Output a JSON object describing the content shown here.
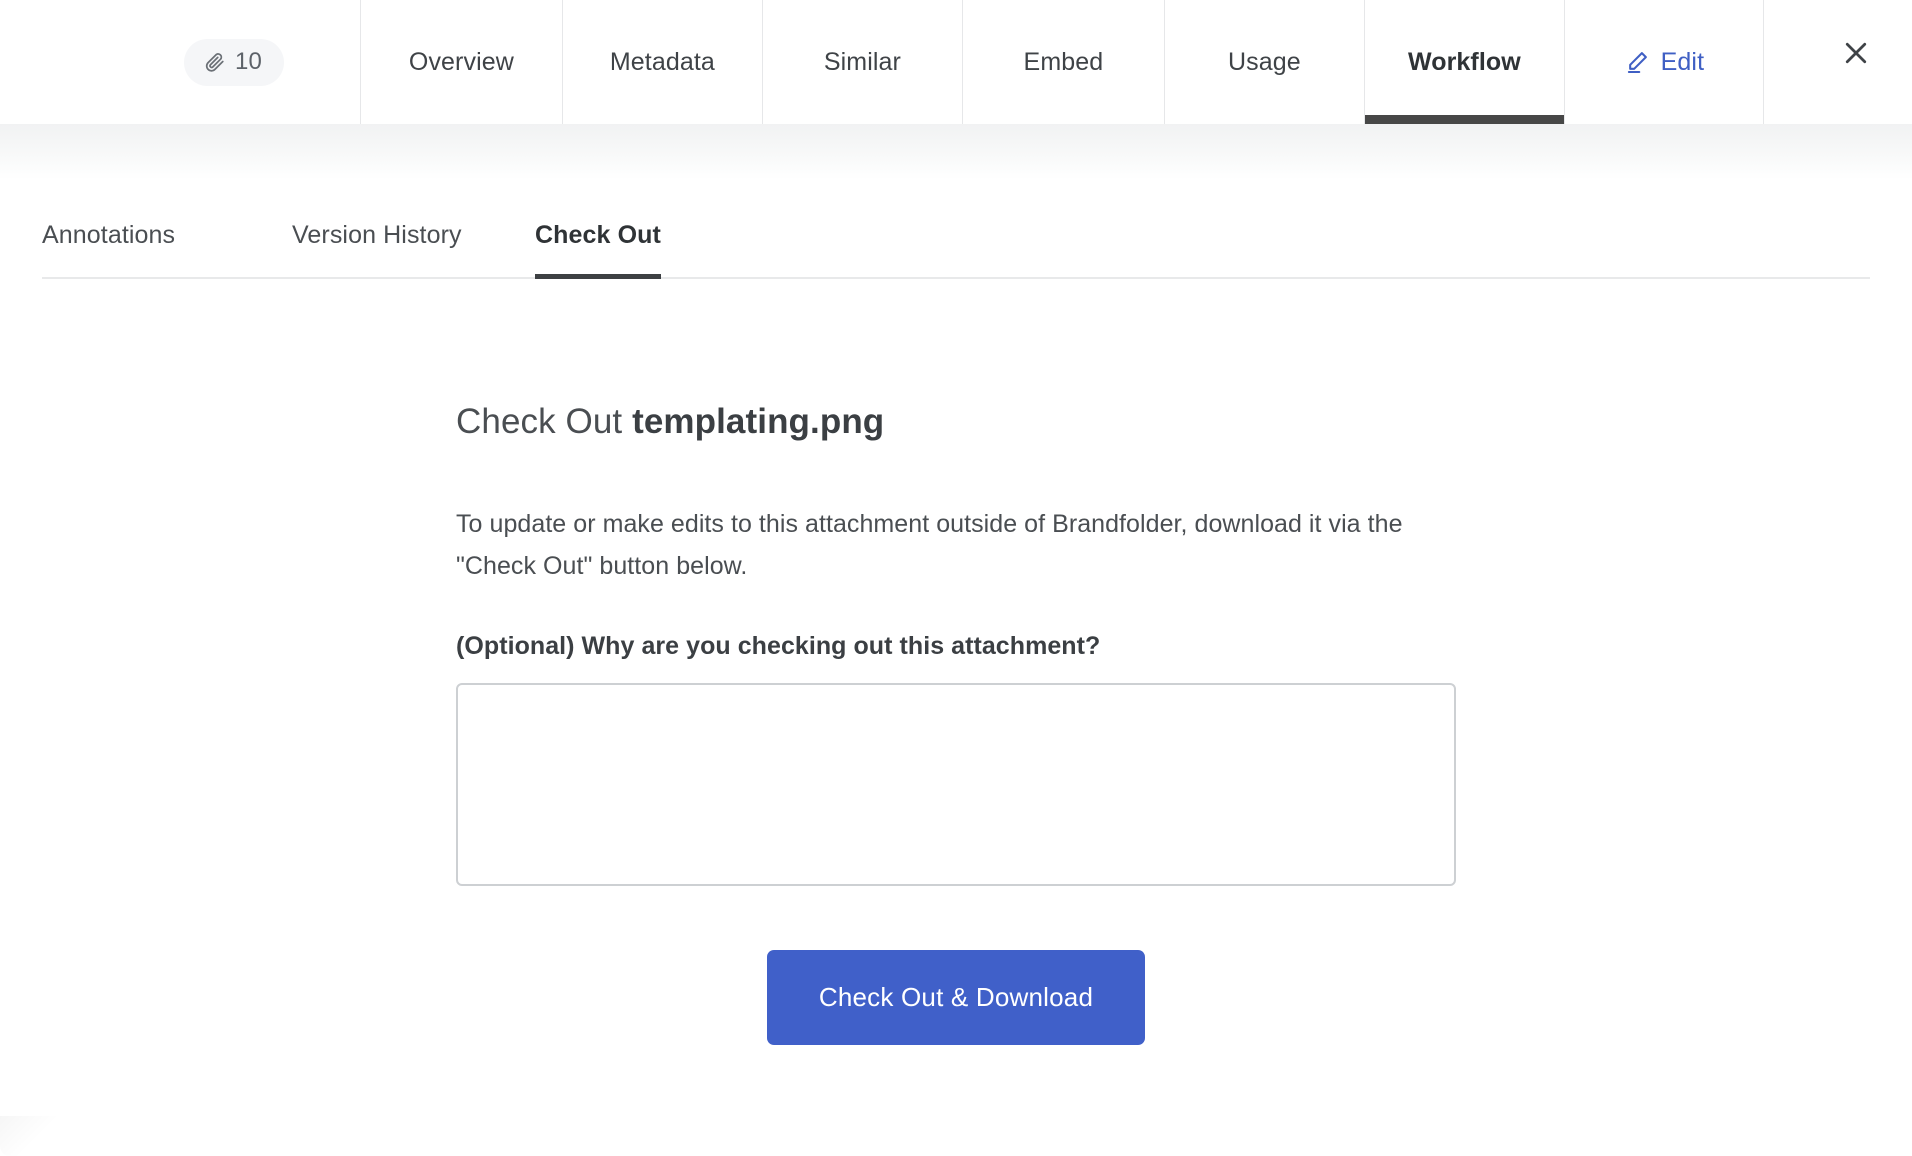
{
  "colors": {
    "accent_blue": "#4060c9",
    "edit_link_blue": "#3f5fc4",
    "active_underline": "#474747",
    "text_primary": "#3b3f43",
    "text_secondary": "#4a4e52",
    "border_light": "#e6e7e9",
    "input_border": "#cdd0d3",
    "badge_background": "#f5f6f8"
  },
  "topbar": {
    "attachment_badge": {
      "icon": "paperclip-icon",
      "count": "10"
    },
    "tabs": [
      {
        "label": "Overview",
        "active": false
      },
      {
        "label": "Metadata",
        "active": false
      },
      {
        "label": "Similar",
        "active": false
      },
      {
        "label": "Embed",
        "active": false
      },
      {
        "label": "Usage",
        "active": false
      },
      {
        "label": "Workflow",
        "active": true
      }
    ],
    "edit": {
      "label": "Edit",
      "icon": "pencil-icon"
    },
    "close": {
      "icon": "close-icon"
    }
  },
  "subtabs": [
    {
      "label": "Annotations",
      "active": false
    },
    {
      "label": "Version History",
      "active": false
    },
    {
      "label": "Check Out",
      "active": true
    }
  ],
  "main": {
    "title_prefix": "Check Out ",
    "filename": "templating.png",
    "intro": "To update or make edits to this attachment outside of Brandfolder, download it via the \"Check Out\" button below.",
    "field_label": "(Optional) Why are you checking out this attachment?",
    "notes_value": "",
    "notes_placeholder": "",
    "submit_label": "Check Out & Download"
  }
}
